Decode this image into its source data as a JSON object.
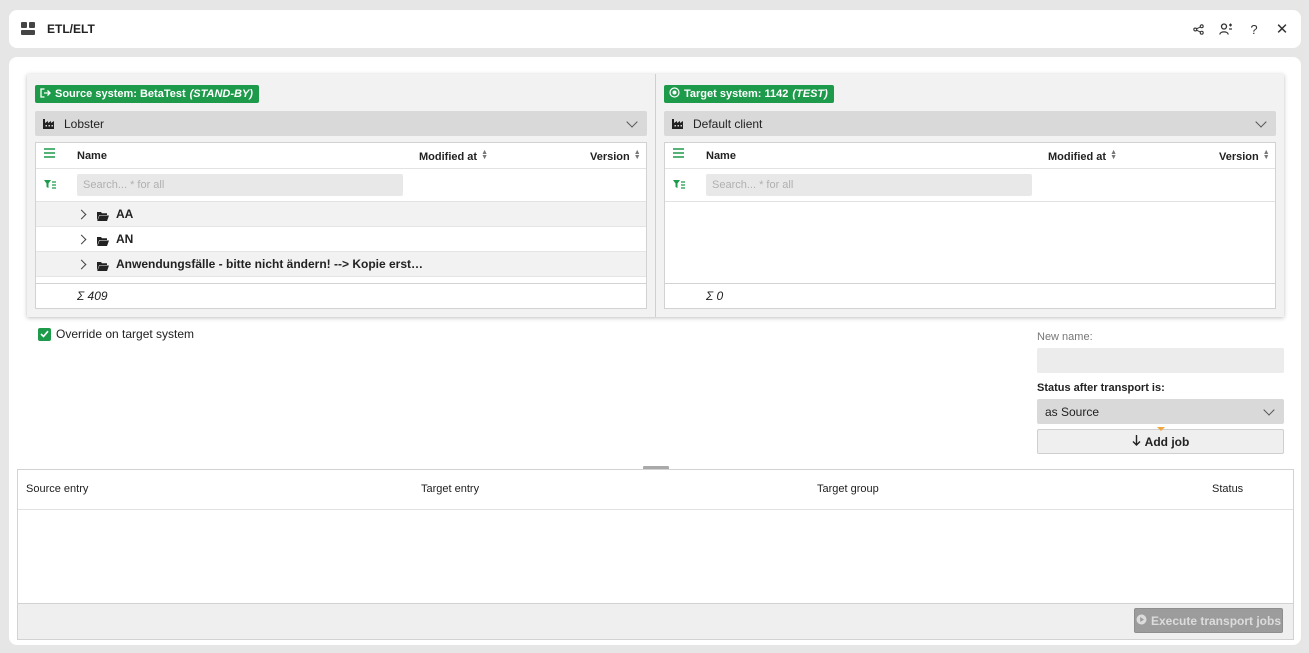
{
  "window": {
    "title": "ETL/ELT",
    "icons": [
      "share-icon",
      "user-switch-icon",
      "help-icon",
      "close-icon"
    ]
  },
  "source": {
    "badge_prefix": "Source system: BetaTest",
    "badge_state": "(STAND-BY)",
    "client": "Lobster",
    "columns": {
      "name": "Name",
      "modified": "Modified at",
      "version": "Version"
    },
    "search_placeholder": "Search... * for all",
    "rows": [
      {
        "label": "AA"
      },
      {
        "label": "AN"
      },
      {
        "label": "Anwendungsfälle - bitte nicht ändern! --> Kopie erst…"
      }
    ],
    "total": "Σ 409"
  },
  "target": {
    "badge_prefix": "Target system: 1142",
    "badge_state": "(TEST)",
    "client": "Default client",
    "columns": {
      "name": "Name",
      "modified": "Modified at",
      "version": "Version"
    },
    "search_placeholder": "Search... * for all",
    "total": "Σ 0"
  },
  "override_label": "Override on target system",
  "form": {
    "new_name_label": "New name:",
    "status_label": "Status after transport is:",
    "status_value": "as Source",
    "add_job": "Add job"
  },
  "jobs": {
    "columns": {
      "source": "Source entry",
      "target": "Target entry",
      "group": "Target group",
      "status": "Status"
    },
    "execute_label": "Execute transport jobs"
  },
  "colors": {
    "accent": "#1e9a4b",
    "highlight": "#f0a63c"
  }
}
